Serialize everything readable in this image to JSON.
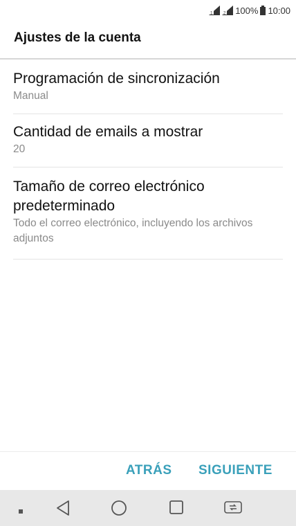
{
  "status_bar": {
    "battery_percent": "100%",
    "time": "10:00",
    "icons": [
      "sim-1-signal-icon",
      "sim-2-signal-icon",
      "battery-icon"
    ]
  },
  "header": {
    "title": "Ajustes de la cuenta"
  },
  "settings": [
    {
      "title": "Programación de sincronización",
      "value": "Manual"
    },
    {
      "title": "Cantidad de emails a mostrar",
      "value": "20"
    },
    {
      "title": "Tamaño de correo electrónico predeterminado",
      "value": "Todo el correo electrónico, incluyendo los archivos adjuntos"
    }
  ],
  "actions": {
    "back_label": "ATRÁS",
    "next_label": "SIGUIENTE"
  },
  "navigation": {
    "icons": [
      "square-dot-icon",
      "back-triangle-icon",
      "home-circle-icon",
      "recents-square-icon",
      "dual-window-icon"
    ]
  },
  "colors": {
    "accent": "#3aa0ba",
    "secondary_text": "#8a8a8a",
    "nav_background": "#e8e8e8"
  }
}
